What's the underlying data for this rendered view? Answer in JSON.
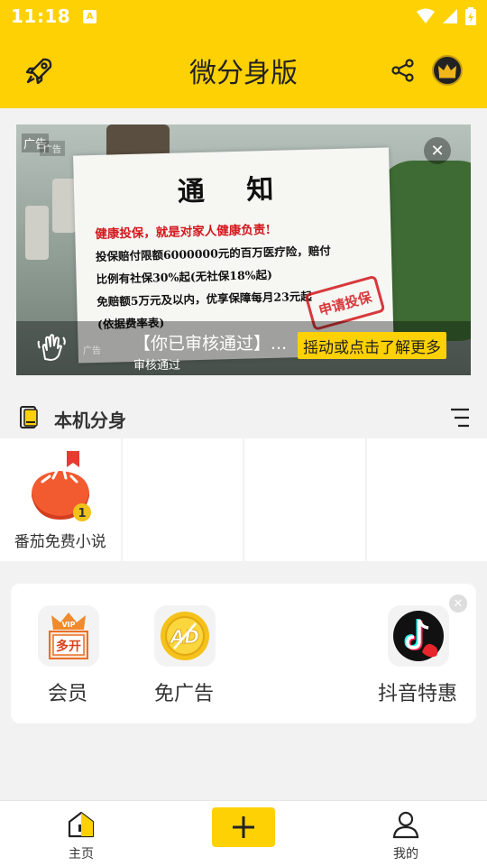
{
  "status_bar": {
    "time": "11:18",
    "notification_glyph": "A",
    "icons": [
      "wifi-icon",
      "signal-icon",
      "battery-charging-icon"
    ]
  },
  "header": {
    "title": "微分身版",
    "icons": [
      "rocket-icon",
      "share-icon",
      "vip-crown-icon"
    ]
  },
  "ad": {
    "tag": "广告",
    "secondary_tag": "广告",
    "notice_title": "通 知",
    "notice_highlight": "健康投保，就是对家人健康负责!",
    "notice_lines": [
      "投保赔付限额6000000元的百万医疗险，赔付",
      "比例有社保30%起(无社保18%起)",
      "免赔额5万元及以内，优享保障每月23元起",
      "(依据费率表)"
    ],
    "stamp": "申请投保",
    "small_tag": "广告",
    "headline": "【你已审核通过】...",
    "subtitle": "审核通过",
    "cta": "摇动或点击了解更多",
    "accent": "#fed105"
  },
  "section": {
    "title": "本机分身"
  },
  "apps": [
    {
      "label": "番茄免费小说",
      "badge": "1",
      "icon": "tomato-novel-icon"
    }
  ],
  "promo": {
    "items": [
      {
        "label": "会员",
        "icon": "vip-multi-open-icon",
        "icon_text": "多开",
        "crown_text": "VIP"
      },
      {
        "label": "免广告",
        "icon": "no-ads-icon",
        "icon_text": "AD"
      },
      {
        "label": "抖音特惠",
        "icon": "douyin-icon"
      }
    ]
  },
  "bottom_nav": {
    "items": [
      {
        "label": "主页",
        "icon": "home-icon"
      },
      {
        "label": "我的",
        "icon": "profile-icon"
      }
    ],
    "add_icon": "plus-icon"
  },
  "colors": {
    "brand": "#fed105",
    "text": "#222222",
    "background": "#f2f2f2"
  }
}
